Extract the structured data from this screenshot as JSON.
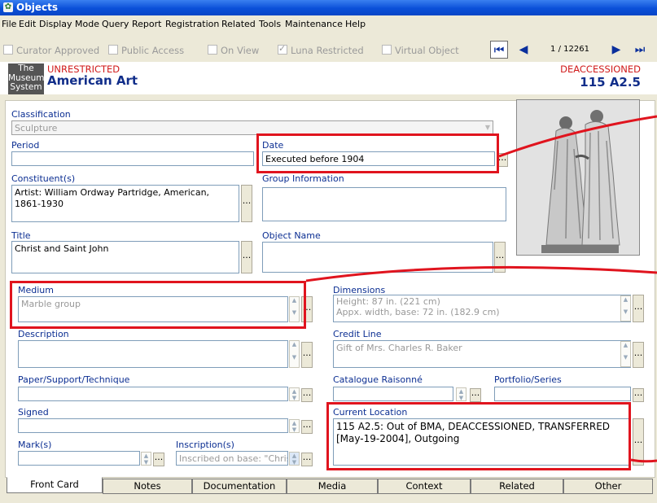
{
  "window": {
    "title": "Objects"
  },
  "menu": [
    "File",
    "Edit",
    "Display Mode",
    "Query",
    "Report",
    "Registration",
    "Related",
    "Tools",
    "Maintenance",
    "Help"
  ],
  "flags": [
    {
      "label": "Curator Approved",
      "checked": false
    },
    {
      "label": "Public Access",
      "checked": false
    },
    {
      "label": "On View",
      "checked": false
    },
    {
      "label": "Luna Restricted",
      "checked": true
    },
    {
      "label": "Virtual Object",
      "checked": false
    }
  ],
  "nav": {
    "record": "1 / 12261",
    "first": "⏮",
    "prev": "◀",
    "next": "▶",
    "last": "⏭"
  },
  "header": {
    "logo": [
      "The",
      "Museum",
      "System"
    ],
    "restriction": "UNRESTRICTED",
    "department": "American Art",
    "status": "DEACCESSIONED",
    "object_number": "115 A2.5"
  },
  "fields": {
    "classification": {
      "label": "Classification",
      "value": "Sculpture"
    },
    "period": {
      "label": "Period",
      "value": ""
    },
    "date": {
      "label": "Date",
      "value": "Executed before 1904"
    },
    "constituents": {
      "label": "Constituent(s)",
      "value": "Artist: William Ordway Partridge, American, 1861-1930"
    },
    "group_info": {
      "label": "Group Information",
      "value": ""
    },
    "title": {
      "label": "Title",
      "value": "Christ and Saint John"
    },
    "object_name": {
      "label": "Object Name",
      "value": ""
    },
    "medium": {
      "label": "Medium",
      "value": "Marble group"
    },
    "dimensions": {
      "label": "Dimensions",
      "line1": "Height: 87 in. (221 cm)",
      "line2": "Appx. width, base: 72 in. (182.9 cm)"
    },
    "description": {
      "label": "Description",
      "value": ""
    },
    "credit_line": {
      "label": "Credit Line",
      "value": "Gift of Mrs. Charles R. Baker"
    },
    "paper_support": {
      "label": "Paper/Support/Technique",
      "value": ""
    },
    "catalogue": {
      "label": "Catalogue Raisonné",
      "value": ""
    },
    "portfolio": {
      "label": "Portfolio/Series",
      "value": ""
    },
    "signed": {
      "label": "Signed",
      "value": ""
    },
    "current_location": {
      "label": "Current Location",
      "value": "115 A2.5: Out of BMA, DEACCESSIONED, TRANSFERRED [May-19-2004], Outgoing"
    },
    "marks": {
      "label": "Mark(s)",
      "value": ""
    },
    "inscriptions": {
      "label": "Inscription(s)",
      "value": "Inscribed on base: \"Christ"
    }
  },
  "dots_label": "...",
  "tabs": [
    "Front Card",
    "Notes",
    "Documentation",
    "Media",
    "Context",
    "Related",
    "Other"
  ],
  "colors": {
    "label_blue": "#0b2e92",
    "restricted_red": "#d01a1a",
    "highlight_red": "#e0141e",
    "title_blue": "#0a4fd8"
  }
}
